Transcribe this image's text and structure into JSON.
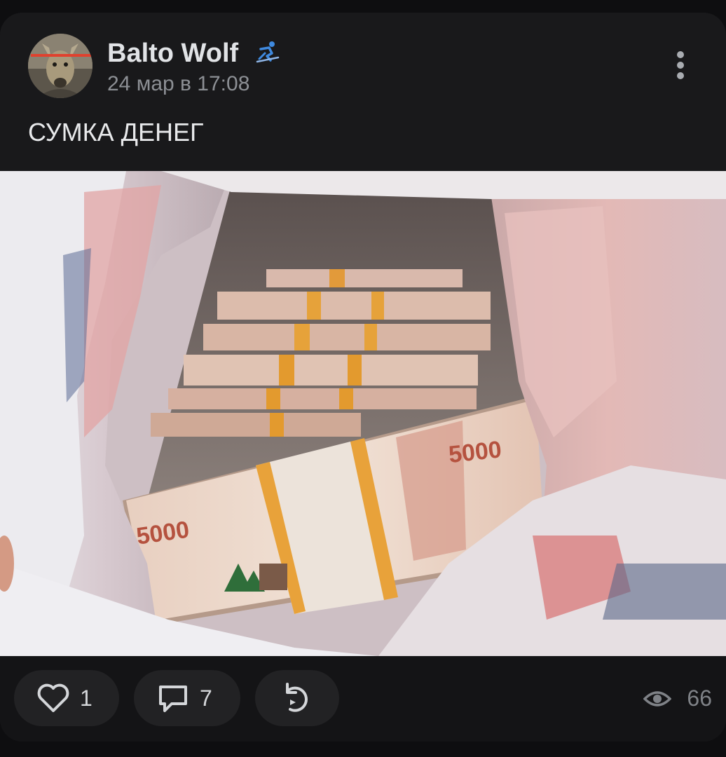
{
  "post": {
    "author": "Balto Wolf",
    "date": "24 мар в 17:08",
    "text": "СУМКА ДЕНЕГ"
  },
  "photo": {
    "banknote_label": "5000"
  },
  "actions": {
    "likes": "1",
    "comments": "7",
    "views": "66"
  },
  "icons": {
    "author_badge": "skier-icon",
    "menu": "more-vertical-icon",
    "like": "heart-outline-icon",
    "comment": "comment-bubble-icon",
    "share": "share-arrow-icon",
    "views": "eye-icon"
  },
  "colors": {
    "background": "#0e0e10",
    "card": "#19191b",
    "footer": "#141416",
    "pill": "#222224",
    "text_primary": "#e1e3e6",
    "text_secondary": "#8c8f94",
    "badge_blue": "#3f8ae0"
  }
}
